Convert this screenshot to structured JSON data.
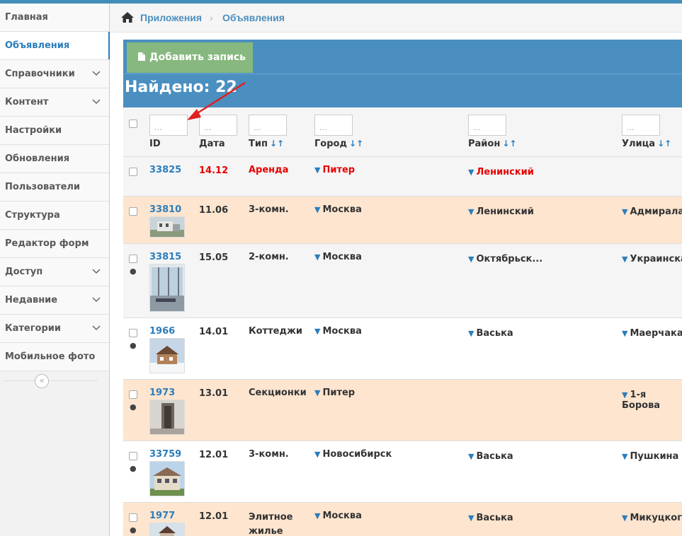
{
  "sidebar": {
    "items": [
      {
        "label": "Главная"
      },
      {
        "label": "Объявления",
        "active": true
      },
      {
        "label": "Справочники",
        "chevron": true
      },
      {
        "label": "Контент",
        "chevron": true
      },
      {
        "label": "Настройки"
      },
      {
        "label": "Обновления"
      },
      {
        "label": "Пользователи"
      },
      {
        "label": "Структура"
      },
      {
        "label": "Редактор форм"
      },
      {
        "label": "Доступ",
        "chevron": true
      },
      {
        "label": "Недавние",
        "chevron": true
      },
      {
        "label": "Категории",
        "chevron": true
      },
      {
        "label": "Мобильное фото"
      }
    ],
    "collapse_icon": "«"
  },
  "breadcrumb": {
    "home_icon": "home-icon",
    "items": [
      "Приложения",
      "Объявления"
    ],
    "separator": "›"
  },
  "toolbar": {
    "add_label": "Добавить запись"
  },
  "results": {
    "found_text": "Найдено: 22"
  },
  "table": {
    "filter_placeholder": "...",
    "sort_glyph": "↓↑",
    "columns": [
      {
        "label": "ID",
        "sortable": false
      },
      {
        "label": "Дата",
        "sortable": false
      },
      {
        "label": "Тип",
        "sortable": true
      },
      {
        "label": "Город",
        "sortable": true
      },
      {
        "label": "Район",
        "sortable": true
      },
      {
        "label": "Улица",
        "sortable": true
      }
    ],
    "rows": [
      {
        "id": "33825",
        "date": "14.12",
        "type": "Аренда",
        "city": "Питер",
        "district": "Ленинский",
        "street": "",
        "highlight": "red",
        "globe": false
      },
      {
        "id": "33810",
        "date": "11.06",
        "type": "3-комн.",
        "city": "Москва",
        "district": "Ленинский",
        "street": "Адмирала",
        "globe": false
      },
      {
        "id": "33815",
        "date": "15.05",
        "type": "2-комн.",
        "city": "Москва",
        "district": "Октябрьск...",
        "street": "Украинская",
        "globe": true
      },
      {
        "id": "1966",
        "date": "14.01",
        "type": "Коттеджи",
        "city": "Москва",
        "district": "Васька",
        "street": "Маерчака",
        "globe": true
      },
      {
        "id": "1973",
        "date": "13.01",
        "type": "Секционки",
        "city": "Питер",
        "district": "",
        "street": "1-я Борова",
        "globe": true
      },
      {
        "id": "33759",
        "date": "12.01",
        "type": "3-комн.",
        "city": "Новосибирск",
        "district": "Васька",
        "street": "Пушкина",
        "globe": true
      },
      {
        "id": "1977",
        "date": "12.01",
        "type": "Элитное жилье",
        "city": "Москва",
        "district": "Васька",
        "street": "Микуцкого",
        "globe": true
      }
    ]
  },
  "colors": {
    "brand_blue": "#4b8fc0",
    "add_button": "#87b87f",
    "row_peach": "#fde5cf",
    "link_blue": "#2b7dbc",
    "alert_red": "#e60000",
    "annotation_arrow": "#e02020"
  }
}
